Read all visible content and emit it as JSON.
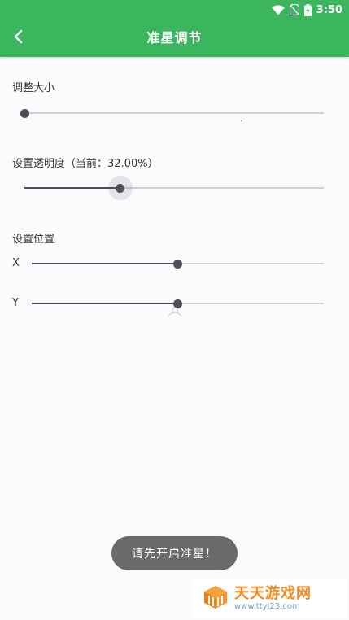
{
  "status_bar": {
    "time": "3:50",
    "icons": [
      "wifi-icon",
      "no-sim-icon",
      "battery-charging-icon"
    ]
  },
  "app_bar": {
    "back_icon": "chevron-left-icon",
    "title": "准星调节"
  },
  "size_section": {
    "label": "调整大小",
    "value": 0.0
  },
  "opacity_section": {
    "label": "设置透明度（当前：32.00%）",
    "value": 0.32
  },
  "position_section": {
    "label": "设置位置",
    "x": {
      "label": "X",
      "value": 0.5
    },
    "y": {
      "label": "Y",
      "value": 0.5
    }
  },
  "toast": {
    "message": "请先开启准星！"
  },
  "watermark": {
    "title": "天天游戏网",
    "url": "www.ttyl23.com"
  },
  "colors": {
    "primary": "#3cb65e",
    "slider_active": "#4f4f5c",
    "slider_track": "#cfcfd4",
    "toast_bg": "#6a6a6a",
    "background": "#fbfafd"
  }
}
